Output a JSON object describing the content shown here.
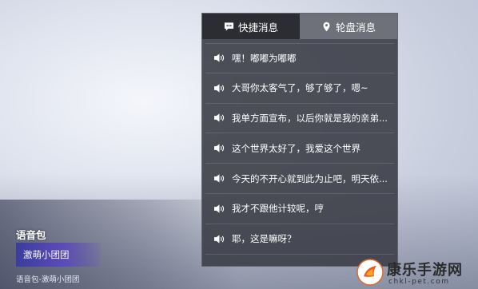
{
  "panel": {
    "tabs": [
      {
        "label": "快捷消息",
        "icon": "chat-bubble-icon",
        "active": true
      },
      {
        "label": "轮盘消息",
        "icon": "location-pin-icon",
        "active": false
      }
    ],
    "messages": [
      {
        "text": "嘿！嘟嘟为嘟嘟"
      },
      {
        "text": "大哥你太客气了，够了够了，嗯~"
      },
      {
        "text": "我单方面宣布，以后你就是我的亲弟..."
      },
      {
        "text": "这个世界太好了，我爱这个世界"
      },
      {
        "text": "今天的不开心就到此为止吧，明天依..."
      },
      {
        "text": "我才不跟他计较呢，哼"
      },
      {
        "text": "耶，这是嘛呀？"
      }
    ]
  },
  "voice_pack": {
    "title": "语音包",
    "selected": "激萌小团团",
    "caption": "语音包-激萌小团团"
  },
  "watermark": {
    "name": "康乐手游网",
    "url": "chkl-pet.com"
  },
  "colors": {
    "panel_bg": "#3e404a",
    "tab_active": "#2c2d33",
    "tab_inactive": "#6f717a",
    "voice_chip": "#4a44a8"
  }
}
